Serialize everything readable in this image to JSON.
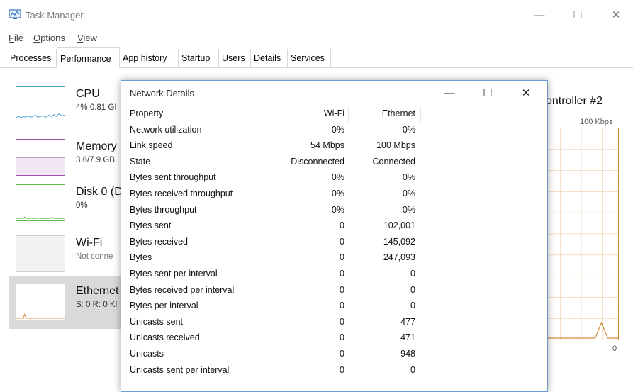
{
  "window": {
    "title": "Task Manager",
    "min_glyph": "—",
    "max_glyph": "☐",
    "close_glyph": "✕"
  },
  "menu": [
    {
      "label": "File",
      "accel": "F"
    },
    {
      "label": "Options",
      "accel": "O"
    },
    {
      "label": "View",
      "accel": "V"
    }
  ],
  "tabs": [
    "Processes",
    "Performance",
    "App history",
    "Startup",
    "Users",
    "Details",
    "Services"
  ],
  "active_tab": "Performance",
  "resources": [
    {
      "name": "CPU",
      "sub": "4% 0.81 GI",
      "color": "#4a9fd4"
    },
    {
      "name": "Memory",
      "sub": "3.6/7.9 GB",
      "color": "#9b4fa6"
    },
    {
      "name": "Disk 0 (D",
      "sub": "0%",
      "color": "#5fb848"
    },
    {
      "name": "Wi-Fi",
      "sub": "Not conne",
      "color": "#cfcfcf"
    },
    {
      "name": "Ethernet",
      "sub": "S: 0 R: 0 Kl",
      "color": "#d28b3a"
    }
  ],
  "right_panel": {
    "title": "ontroller #2",
    "scale_max": "100 Kbps",
    "scale_min": "0"
  },
  "dialog": {
    "title": "Network Details",
    "columns": [
      "Property",
      "Wi-Fi",
      "Ethernet"
    ],
    "rows": [
      [
        "Network utilization",
        "0%",
        "0%"
      ],
      [
        "Link speed",
        "54 Mbps",
        "100 Mbps"
      ],
      [
        "State",
        "Disconnected",
        "Connected"
      ],
      [
        "Bytes sent throughput",
        "0%",
        "0%"
      ],
      [
        "Bytes received throughput",
        "0%",
        "0%"
      ],
      [
        "Bytes throughput",
        "0%",
        "0%"
      ],
      [
        "Bytes sent",
        "0",
        "102,001"
      ],
      [
        "Bytes received",
        "0",
        "145,092"
      ],
      [
        "Bytes",
        "0",
        "247,093"
      ],
      [
        "Bytes sent per interval",
        "0",
        "0"
      ],
      [
        "Bytes received per interval",
        "0",
        "0"
      ],
      [
        "Bytes per interval",
        "0",
        "0"
      ],
      [
        "Unicasts sent",
        "0",
        "477"
      ],
      [
        "Unicasts received",
        "0",
        "471"
      ],
      [
        "Unicasts",
        "0",
        "948"
      ],
      [
        "Unicasts sent per interval",
        "0",
        "0"
      ]
    ]
  }
}
